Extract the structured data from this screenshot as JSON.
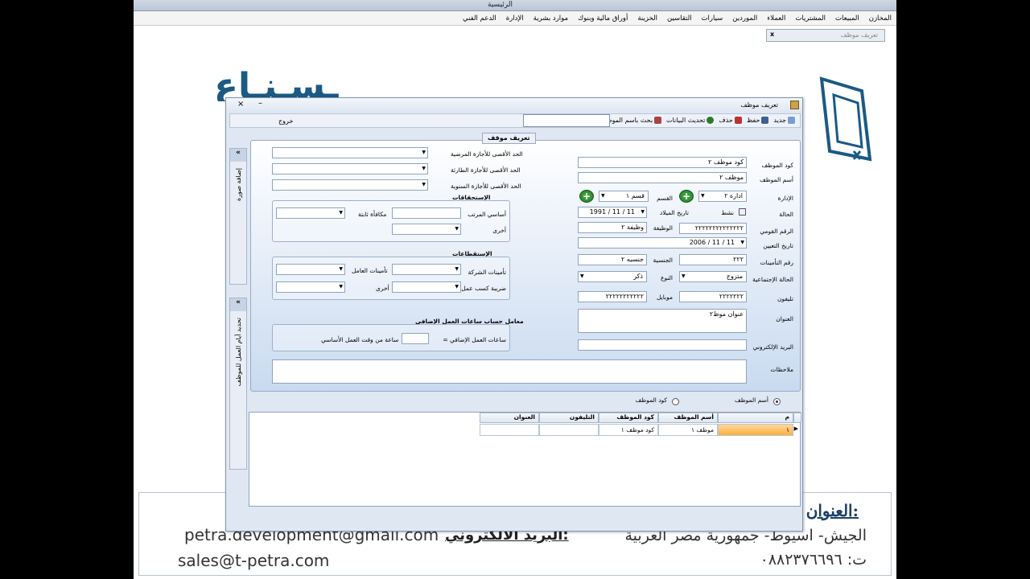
{
  "app": {
    "title": "الرئيسية"
  },
  "menu": [
    "المخازن",
    "المبيعات",
    "المشتريات",
    "العملاء",
    "الموردين",
    "سيارات",
    "التقاسين",
    "الخزينة",
    "أوراق مالية وبنوك",
    "موارد بشرية",
    "الإدارة",
    "الدعم الفني"
  ],
  "tab": {
    "label": "تعريف موظف",
    "close": "x"
  },
  "background": {
    "brand_text": "ـسـنـاع ـمـتـا",
    "address_label": "العنوان:",
    "address": "الجيش- اسيوط- جمهورية مصر العربية",
    "phone": "ت: ٠٨٨٢٣٧٦٦٩٦",
    "email_label": "البريد الالكتروني:",
    "email1": "petra.development@gmail.com",
    "email2": "sales@t-petra.com"
  },
  "dialog": {
    "title": "تعريف موظف",
    "close": "×",
    "minimize": "–",
    "toolbar": {
      "new": "جديد",
      "save": "حفظ",
      "delete": "حذف",
      "refresh": "تحديث البيانات",
      "search_by_name": "بحث باسم الموظف",
      "exit": "خروج"
    },
    "side1": {
      "arrow": "«",
      "label": "إضافة صورة"
    },
    "side2": {
      "arrow": "«",
      "label": "تحديد أيام العمل للموظف"
    },
    "section_title": "تعريف موقف",
    "fields": {
      "code": {
        "label": "كود الموظف",
        "value": "كود موظف ٢"
      },
      "name": {
        "label": "أسم الموظف",
        "value": "موظف ٢"
      },
      "department": {
        "label": "الإدارة",
        "value": "ادارة ٢"
      },
      "section": {
        "label": "القسم",
        "value": "قسم ١"
      },
      "status": {
        "label": "الحالة",
        "active_label": "نشط"
      },
      "birth_date": {
        "label": "تاريخ الميلاد",
        "value": "11 / 11 / 1991"
      },
      "national_id": {
        "label": "الرقم القومي",
        "value": "٢٢٢٢٢٢٢٢٢٢٢٢٢٢"
      },
      "job": {
        "label": "الوظيفة",
        "value": "وظيفة ٢"
      },
      "hire_date": {
        "label": "تاريخ التعيين",
        "value": "11 / 11 / 2006"
      },
      "insurance_no": {
        "label": "رقم التأمينات",
        "value": "٢٢٢"
      },
      "nationality": {
        "label": "الجنسية",
        "value": "جنسيه ٢"
      },
      "marital": {
        "label": "الحالة الإجتماعية",
        "value": "متزوج"
      },
      "gender": {
        "label": "النوع",
        "value": "ذكر"
      },
      "phone": {
        "label": "تليفون",
        "value": "٢٢٢٢٢٢٢"
      },
      "mobile": {
        "label": "موبايل",
        "value": "٢٢٢٢٢٢٢٢٢٢٢"
      },
      "address": {
        "label": "العنوان",
        "value": "عنوان موظ٢"
      },
      "email": {
        "label": "البريد الإلكتروني",
        "value": ""
      },
      "notes": {
        "label": "ملاحظات",
        "value": ""
      }
    },
    "leave": {
      "sick": "الحد الأقصى للأجازة المرضية",
      "casual": "الحد الأقصى للأجازة الطارئة",
      "annual": "الحد الأقصى للأجازة السنوية"
    },
    "entitlements": {
      "title": "الإستحقاقات",
      "basic": "أساسي المرتب",
      "fixed_bonus": "مكافأة ثابتة",
      "other": "أخرى"
    },
    "deductions": {
      "title": "الإستقطاعات",
      "company_ins": "تأمينات الشركة",
      "worker_ins": "تأمينات العامل",
      "tax": "ضريبة كسب عمل",
      "other": "أخرى"
    },
    "overtime": {
      "title": "معامل حساب ساعات العمل الإضافي",
      "label": "ساعات العمل الإضافي =",
      "suffix": "ساعة من وقت العمل الأساسي"
    },
    "search_mode": {
      "by_name": "أسم الموظف",
      "by_code": "كود الموظف"
    },
    "grid": {
      "columns": [
        "م",
        "أسم الموظف",
        "كود الموظف",
        "التليفون",
        "العنوان"
      ],
      "rows": [
        [
          "١",
          "موظف ١",
          "كود موظف ١",
          "",
          ""
        ]
      ]
    }
  }
}
